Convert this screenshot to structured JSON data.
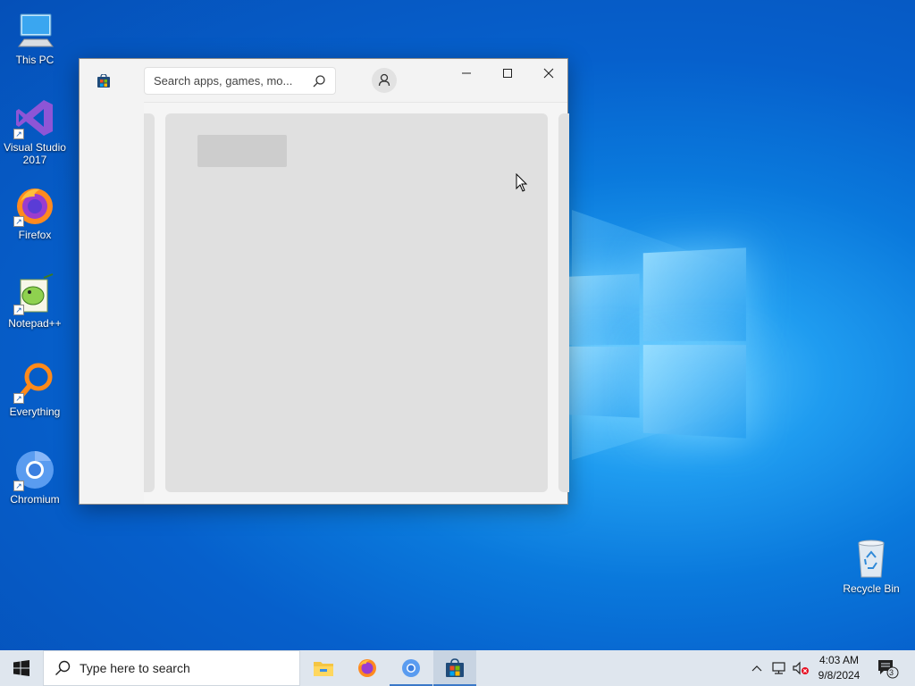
{
  "desktop": {
    "icons": [
      {
        "label": "This PC",
        "icon": "computer-icon"
      },
      {
        "label": "Visual Studio 2017",
        "icon": "visual-studio-icon"
      },
      {
        "label": "Firefox",
        "icon": "firefox-icon"
      },
      {
        "label": "Notepad++",
        "icon": "notepadpp-icon"
      },
      {
        "label": "Everything",
        "icon": "everything-search-icon"
      },
      {
        "label": "Chromium",
        "icon": "chromium-icon"
      }
    ],
    "recycle_bin": {
      "label": "Recycle Bin",
      "icon": "recycle-bin-icon"
    }
  },
  "store_window": {
    "search": {
      "placeholder": "Search apps, games, mo..."
    },
    "controls": {
      "minimize": "minimize-icon",
      "maximize": "maximize-icon",
      "close": "close-icon"
    }
  },
  "taskbar": {
    "search_placeholder": "Type here to search",
    "apps": [
      "file-explorer-icon",
      "firefox-icon",
      "chromium-icon",
      "store-icon"
    ],
    "clock": {
      "time": "4:03 AM",
      "date": "9/8/2024"
    },
    "notification_count": "3"
  },
  "colors": {
    "accent": "#0078d7",
    "taskbar_bg": "#dfe6ee",
    "window_bg": "#f3f3f3"
  }
}
